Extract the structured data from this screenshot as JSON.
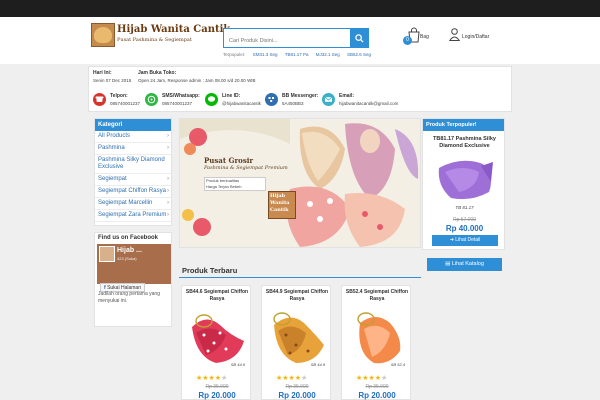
{
  "header": {
    "logo_title": "Hijab Wanita Cantik",
    "logo_tagline": "Pusat Pashmina & Segiempat",
    "search_placeholder": "Cari Produk Disini...",
    "popular_label": "Terpopuler:",
    "popular_items": [
      "SM31.3 Seg",
      "TB81.17 Pa",
      "MJ32.1 Seg",
      "SB62.6 Seg"
    ],
    "cart_count": "0",
    "cart_label": "Bag",
    "login_label": "Login/Daftar"
  },
  "info": {
    "hari_label": "Hari Ini:",
    "hari_value": "Senin 07 Dec 2015",
    "jam_label": "Jam Buka Toko:",
    "jam_value": "Open 24 Jam, Response admin : Jam 08.00 s/d 20.00 WIB",
    "contacts": [
      {
        "label": "Telpon:",
        "value": "085740001237",
        "color": "#d9342b",
        "icon": "phone-icon"
      },
      {
        "label": "SMS/Whatsapp:",
        "value": "085740001237",
        "color": "#2db742",
        "icon": "whatsapp-icon"
      },
      {
        "label": "Line ID:",
        "value": "@hijabwanitacantik",
        "color": "#00b900",
        "icon": "line-icon"
      },
      {
        "label": "BB Messenger:",
        "value": "5A450BB3",
        "color": "#2f6fb0",
        "icon": "bbm-icon"
      },
      {
        "label": "Email:",
        "value": "hijabwanitacantik@gmail.com",
        "color": "#3ab0c8",
        "icon": "email-icon"
      }
    ]
  },
  "sidebar": {
    "title": "Kategori",
    "items": [
      {
        "label": "All Products",
        "chev": "›"
      },
      {
        "label": "Pashmina",
        "chev": "›"
      },
      {
        "label": "Pashmina Silky Diamond Exclusive",
        "chev": ""
      },
      {
        "label": "Segiempat",
        "chev": "›"
      },
      {
        "label": "Segiempat Chiffon Rasya",
        "chev": "›"
      },
      {
        "label": "Segiempat Marcellin",
        "chev": "›"
      },
      {
        "label": "Segiempat Zara Premium",
        "chev": "›"
      }
    ]
  },
  "facebook": {
    "title": "Find us on Facebook",
    "page_name": "Hijab ...",
    "page_sub": "423 (Suka)",
    "like_label": "Sukai Halaman",
    "desc": "Jadilah orang pertama yang menyukai ini."
  },
  "banner": {
    "title_line1": "Pusat Grosir",
    "title_line2": "Pashmina & Segiempat Premium",
    "sub_line1": "Produk berkualitas",
    "sub_line2": "Harga Terjan Bebeh",
    "logo_line1": "Hijab",
    "logo_line2": "Wanita",
    "logo_line3": "Cantik"
  },
  "products": {
    "section_title": "Produk Terbaru",
    "items": [
      {
        "name": "SB44.6 Segiempat Chiffon Rasya",
        "code": "SB 44.6",
        "stars": "★★★★",
        "half": "★",
        "old_price": "Rp 35.000",
        "price": "Rp 20.000",
        "color": "#e23b5a",
        "accent": "#ffffff"
      },
      {
        "name": "SB44.9 Segiempat Chiffon Rasya",
        "code": "SB 44.9",
        "stars": "★★★★",
        "half": "★",
        "old_price": "Rp 35.000",
        "price": "Rp 20.000",
        "color": "#e8a23a",
        "accent": "#9c5a1e"
      },
      {
        "name": "SB52.4 Segiempat Chiffon Rasya",
        "code": "SB 52.4",
        "stars": "★★★★",
        "half": "★",
        "old_price": "Rp 35.000",
        "price": "Rp 20.000",
        "color": "#f48a4a",
        "accent": "#ffb487"
      }
    ]
  },
  "popular_panel": {
    "title": "Produk Terpopuler!",
    "name": "TB81.17 Pashmina Silky Diamond Exclusive",
    "code": "TB 81.17",
    "old_price": "Rp 57.000",
    "price": "Rp 40.000",
    "button_label": "Lihat Detail",
    "color": "#9f6fd8"
  },
  "katalog_button": "Lihat Katalog",
  "theme": {
    "accent": "#2f8fd6",
    "price": "#1e6fc0",
    "topbar": "#1e1e1e"
  }
}
